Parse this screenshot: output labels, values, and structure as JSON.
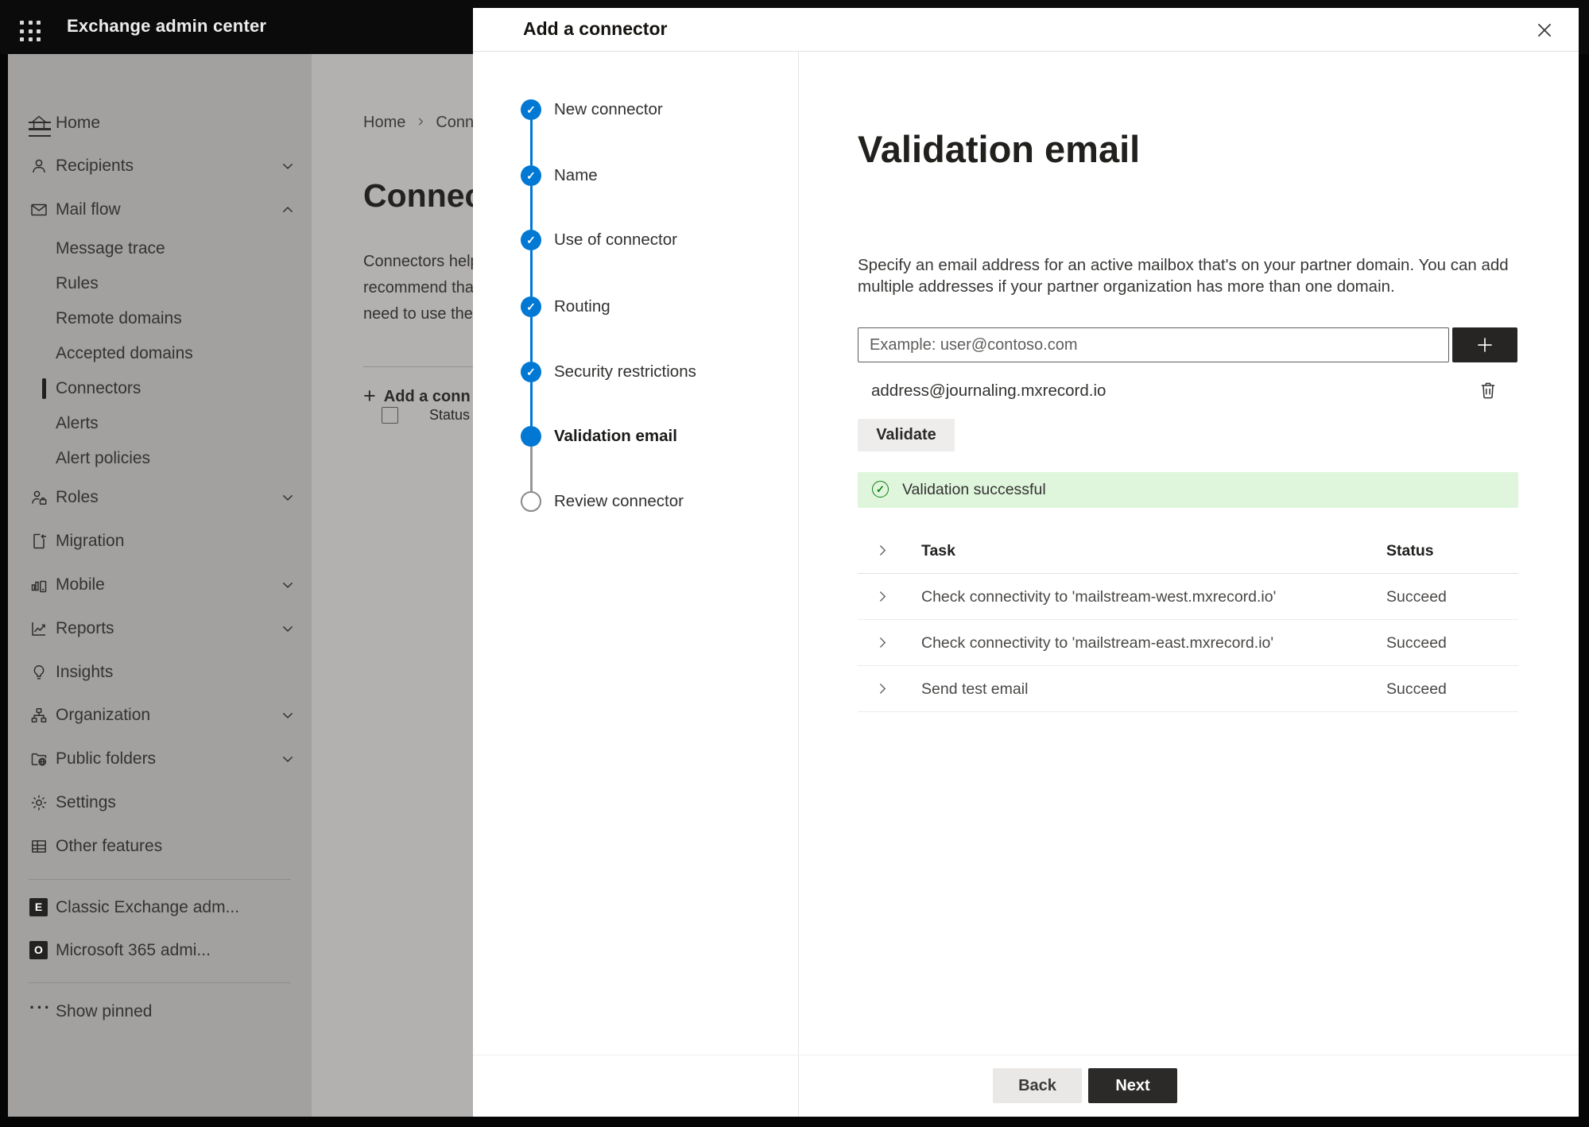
{
  "topbar": {
    "title": "Exchange admin center"
  },
  "sidebar": {
    "items": [
      {
        "label": "Home",
        "icon": "home"
      },
      {
        "label": "Recipients",
        "icon": "person",
        "chevron": "down"
      },
      {
        "label": "Mail flow",
        "icon": "envelope",
        "chevron": "up"
      },
      {
        "label": "Message trace",
        "sub": true
      },
      {
        "label": "Rules",
        "sub": true
      },
      {
        "label": "Remote domains",
        "sub": true
      },
      {
        "label": "Accepted domains",
        "sub": true
      },
      {
        "label": "Connectors",
        "sub": true,
        "selected": true
      },
      {
        "label": "Alerts",
        "sub": true
      },
      {
        "label": "Alert policies",
        "sub": true
      },
      {
        "label": "Roles",
        "icon": "person-briefcase",
        "chevron": "down"
      },
      {
        "label": "Migration",
        "icon": "document-arrow"
      },
      {
        "label": "Mobile",
        "icon": "chart-phone",
        "chevron": "down"
      },
      {
        "label": "Reports",
        "icon": "line-chart",
        "chevron": "down"
      },
      {
        "label": "Insights",
        "icon": "lightbulb"
      },
      {
        "label": "Organization",
        "icon": "org-chart",
        "chevron": "down"
      },
      {
        "label": "Public folders",
        "icon": "folder-globe",
        "chevron": "down"
      },
      {
        "label": "Settings",
        "icon": "gear"
      },
      {
        "label": "Other features",
        "icon": "table-grid"
      },
      {
        "label": "Classic Exchange adm...",
        "icon": "exchange-logo"
      },
      {
        "label": "Microsoft 365 admi...",
        "icon": "office-logo"
      },
      {
        "label": "Show pinned",
        "icon": "ellipsis"
      }
    ]
  },
  "background": {
    "breadcrumb_home": "Home",
    "breadcrumb_current": "Conn",
    "heading": "Connect",
    "para_line1": "Connectors help",
    "para_line2": "recommend tha",
    "para_line3": "need to use ther",
    "add_button": "Add a conn",
    "status_header": "Status"
  },
  "modal": {
    "title": "Add a connector",
    "steps": [
      {
        "label": "New connector",
        "state": "done"
      },
      {
        "label": "Name",
        "state": "done"
      },
      {
        "label": "Use of connector",
        "state": "done"
      },
      {
        "label": "Routing",
        "state": "done"
      },
      {
        "label": "Security restrictions",
        "state": "done"
      },
      {
        "label": "Validation email",
        "state": "current"
      },
      {
        "label": "Review connector",
        "state": "upcoming"
      }
    ],
    "content": {
      "heading": "Validation email",
      "desc_line1": "Specify an email address for an active mailbox that's on your partner domain. You can add",
      "desc_line2": "multiple addresses if your partner organization has more than one domain.",
      "input_placeholder": "Example: user@contoso.com",
      "address": "address@journaling.mxrecord.io",
      "validate_button": "Validate",
      "success_message": "Validation successful",
      "col_task": "Task",
      "col_status": "Status",
      "rows": [
        {
          "task": "Check connectivity to 'mailstream-west.mxrecord.io'",
          "status": "Succeed"
        },
        {
          "task": "Check connectivity to 'mailstream-east.mxrecord.io'",
          "status": "Succeed"
        },
        {
          "task": "Send test email",
          "status": "Succeed"
        }
      ]
    },
    "footer": {
      "back_label": "Back",
      "next_label": "Next"
    }
  },
  "colors": {
    "accent_blue": "#0078d4",
    "success_bg": "#dff6dd",
    "success_green": "#107c10",
    "dark_button": "#2b2a29"
  }
}
